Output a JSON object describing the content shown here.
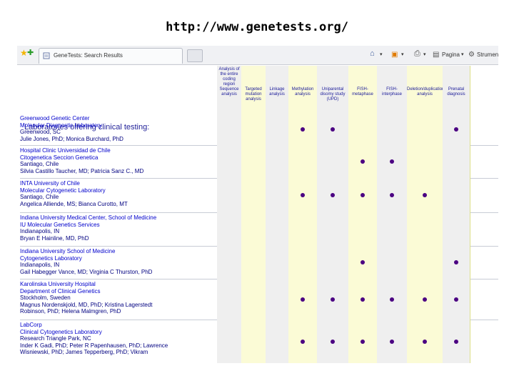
{
  "slide_title": "http://www.genetests.org/",
  "browser": {
    "tab_title": "GeneTests: Search Results",
    "toolbar": {
      "page_label": "Pagina",
      "tools_label": "Strumenti"
    }
  },
  "table": {
    "laboratories_header": "Laboratories offering clinical testing:",
    "columns": [
      "Analysis of the entire coding region Sequence analysis",
      "Targeted mutation analysis",
      "Linkage analysis",
      "Methylation analysis",
      "Uniparental disomy study (UPD)",
      "FISH-metaphase",
      "FISH-interphase",
      "Deletion/duplication analysis",
      "Prenatal diagnosis"
    ],
    "rows": [
      {
        "lines": [
          "Greenwood Genetic Center",
          "Molecular Diagnostic Laboratory",
          "Greenwood, SC",
          "Julie Jones, PhD; Monica Burchard, PhD"
        ],
        "tests": [
          false,
          false,
          false,
          true,
          true,
          false,
          false,
          false,
          true
        ]
      },
      {
        "lines": [
          "Hospital Clinic Universidad de Chile",
          "Citogenetica Seccion Genetica",
          "Santiago, Chile",
          "Silvia Castillo Taucher, MD; Patricia Sanz C., MD"
        ],
        "tests": [
          false,
          false,
          false,
          false,
          false,
          true,
          true,
          false,
          false
        ]
      },
      {
        "lines": [
          "INTA University of Chile",
          "Molecular Cytogenetic Laboratory",
          "Santiago, Chile",
          "Angelica Alliende, MS; Bianca Curotto, MT"
        ],
        "tests": [
          false,
          false,
          false,
          true,
          true,
          true,
          true,
          true,
          false
        ]
      },
      {
        "lines": [
          "Indiana University Medical Center, School of Medicine",
          "IU Molecular Genetics Services",
          "Indianapolis, IN",
          "Bryan E Hainline, MD, PhD"
        ],
        "tests": [
          false,
          false,
          false,
          false,
          false,
          false,
          false,
          false,
          false
        ]
      },
      {
        "lines": [
          "Indiana University School of Medicine",
          "Cytogenetics Laboratory",
          "Indianapolis, IN",
          "Gail Habegger Vance, MD; Virginia C Thurston, PhD"
        ],
        "tests": [
          false,
          false,
          false,
          false,
          false,
          true,
          false,
          false,
          true
        ]
      },
      {
        "lines": [
          "Karolinska University Hospital",
          "Department of Clinical Genetics",
          "Stockholm, Sweden",
          "Magnus Nordenskjold, MD, PhD; Kristina Lagerstedt",
          "Robinson, PhD; Helena Malmgren, PhD"
        ],
        "tests": [
          false,
          false,
          false,
          true,
          true,
          true,
          true,
          true,
          true
        ]
      },
      {
        "lines": [
          "LabCorp",
          "Clinical Cytogenetics Laboratory",
          "Research Triangle Park, NC",
          "Inder K Gadi, PhD; Peter R Papenhausen, PhD; Lawrence",
          "Wisniewski, PhD; James Tepperberg, PhD; Vikram"
        ],
        "tests": [
          false,
          false,
          false,
          true,
          true,
          true,
          true,
          true,
          true
        ]
      }
    ]
  }
}
